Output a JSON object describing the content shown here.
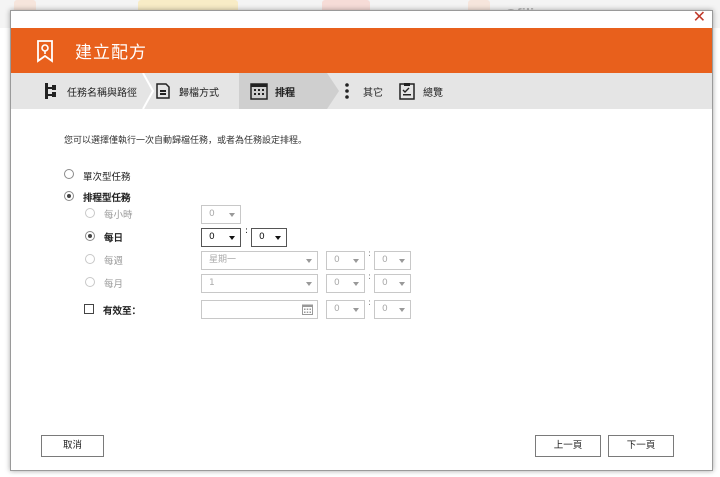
{
  "background": {
    "app_text": "Ofiling"
  },
  "dialog": {
    "title": "建立配方",
    "close_glyph": "✕",
    "accent_color": "#e8601c"
  },
  "steps": [
    {
      "label": "任務名稱與路徑",
      "icon": "tree-icon"
    },
    {
      "label": "歸檔方式",
      "icon": "document-icon"
    },
    {
      "label": "排程",
      "icon": "calendar-icon",
      "active": true
    },
    {
      "label": "其它",
      "icon": "more-icon"
    },
    {
      "label": "總覽",
      "icon": "clipboard-icon"
    }
  ],
  "description": "您可以選擇僅執行一次自動歸檔任務，或者為任務設定排程。",
  "task_type": {
    "once_label": "單次型任務",
    "scheduled_label": "排程型任務",
    "selected": "scheduled"
  },
  "schedule": {
    "hourly": {
      "label": "每小時",
      "minute": "0"
    },
    "daily": {
      "label": "每日",
      "hour": "0",
      "minute": "0",
      "selected": true
    },
    "weekly": {
      "label": "每週",
      "day": "星期一",
      "hour": "0",
      "minute": "0"
    },
    "monthly": {
      "label": "每月",
      "day": "1",
      "hour": "0",
      "minute": "0"
    },
    "valid_until": {
      "label": "有效至：",
      "date": "",
      "hour": "0",
      "minute": "0",
      "checked": false
    },
    "colon": ":"
  },
  "buttons": {
    "cancel": "取消",
    "prev": "上一頁",
    "next": "下一頁"
  }
}
